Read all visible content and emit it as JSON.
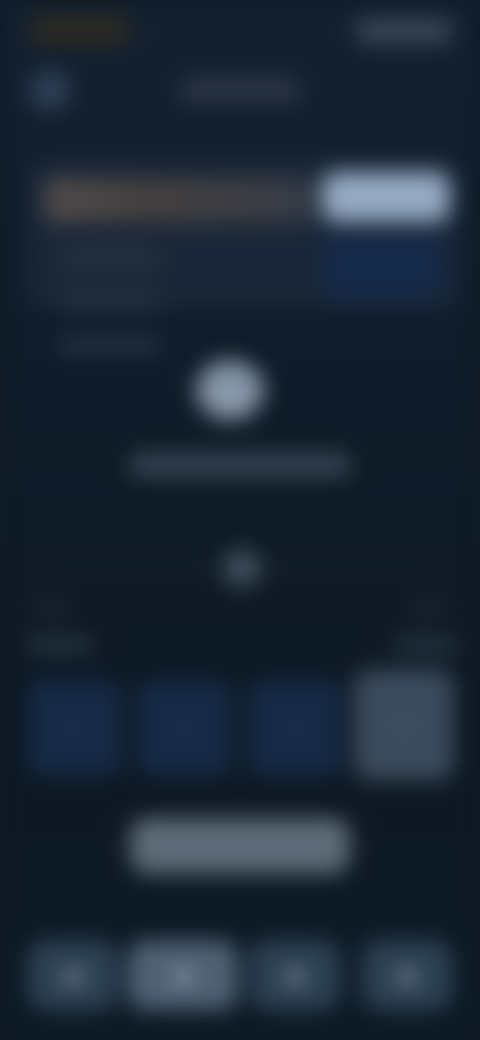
{
  "status_bar": {
    "left_label": "",
    "right_label": ""
  },
  "header": {
    "back_icon": "chevron-left-icon",
    "title": ""
  },
  "hero_card": {
    "name": "",
    "button_label": "",
    "info_lines": [
      "",
      "",
      ""
    ]
  },
  "center": {
    "icon": "gauge-icon",
    "caption": ""
  },
  "divider": {
    "knob_icon": "dot-icon"
  },
  "labels": {
    "left": "",
    "right": ""
  },
  "options": [
    {
      "icon": "option-icon"
    },
    {
      "icon": "option-icon"
    },
    {
      "icon": "option-icon"
    },
    {
      "icon": "option-icon"
    }
  ],
  "cta": {
    "label": ""
  },
  "bottom_nav": [
    {
      "icon": "nav-icon"
    },
    {
      "icon": "nav-icon"
    },
    {
      "icon": "nav-icon"
    },
    {
      "icon": "nav-icon"
    }
  ],
  "colors": {
    "background": "#0f1a25",
    "accent": "#95a9c2",
    "tile": "#162a46",
    "selected_tile": "#3b4b5c"
  }
}
